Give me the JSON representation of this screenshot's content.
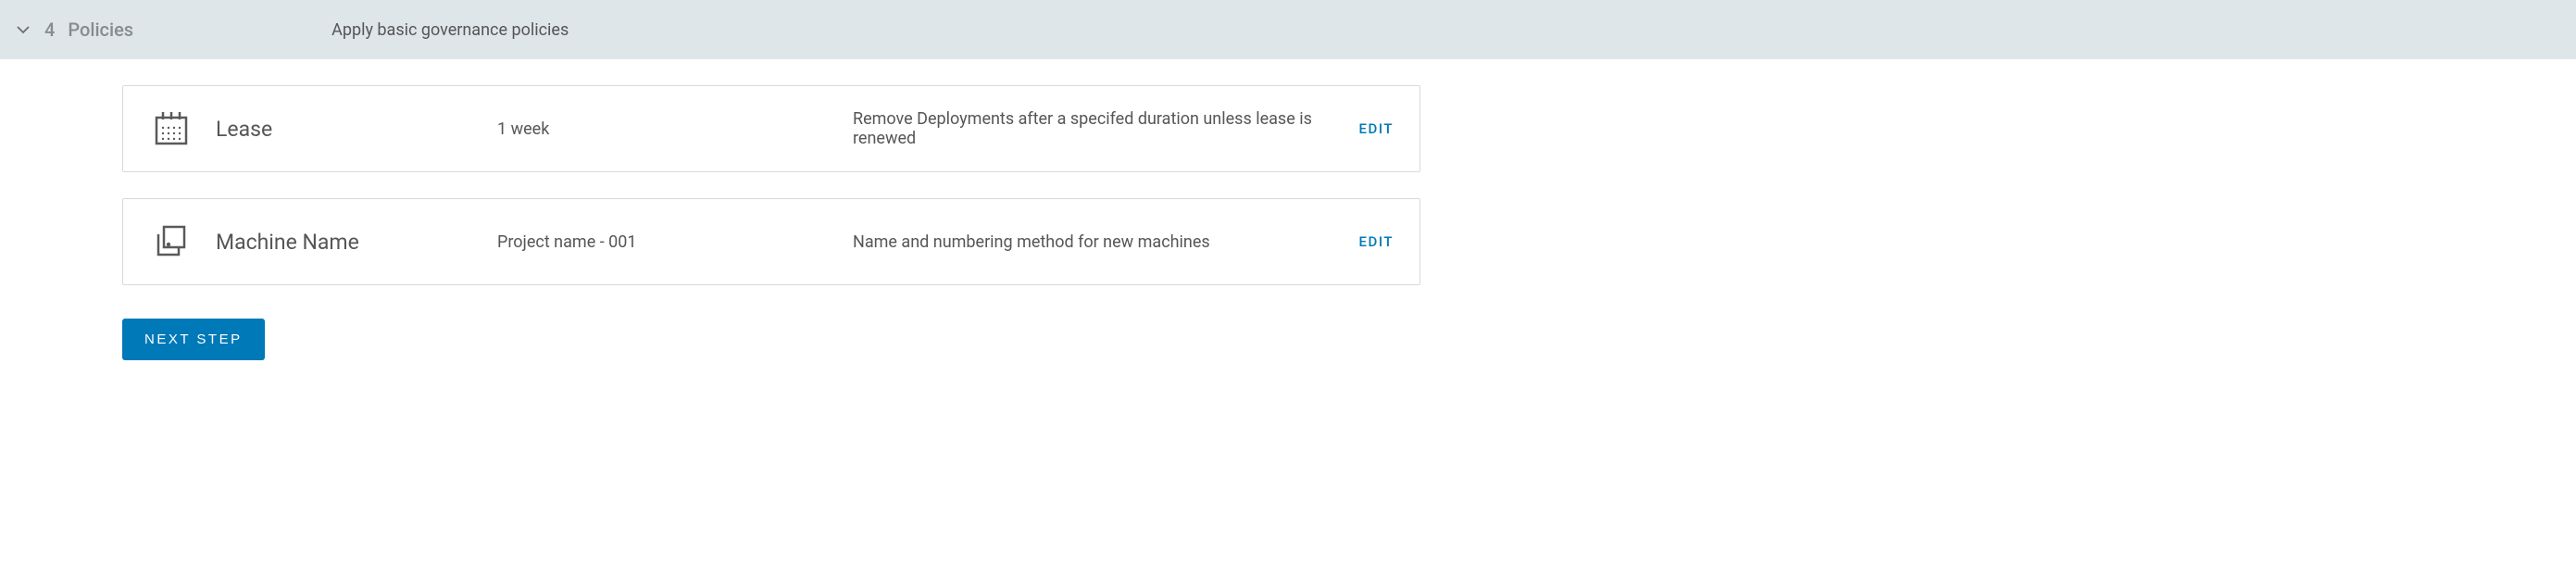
{
  "header": {
    "step_number": "4",
    "step_title": "Policies",
    "step_description": "Apply basic governance policies"
  },
  "policies": [
    {
      "name": "Lease",
      "value": "1 week",
      "description": "Remove Deployments after a specifed duration unless lease is renewed",
      "edit_label": "EDIT"
    },
    {
      "name": "Machine Name",
      "value": "Project name - 001",
      "description": "Name and numbering method for new machines",
      "edit_label": "EDIT"
    }
  ],
  "next_button_label": "NEXT STEP"
}
